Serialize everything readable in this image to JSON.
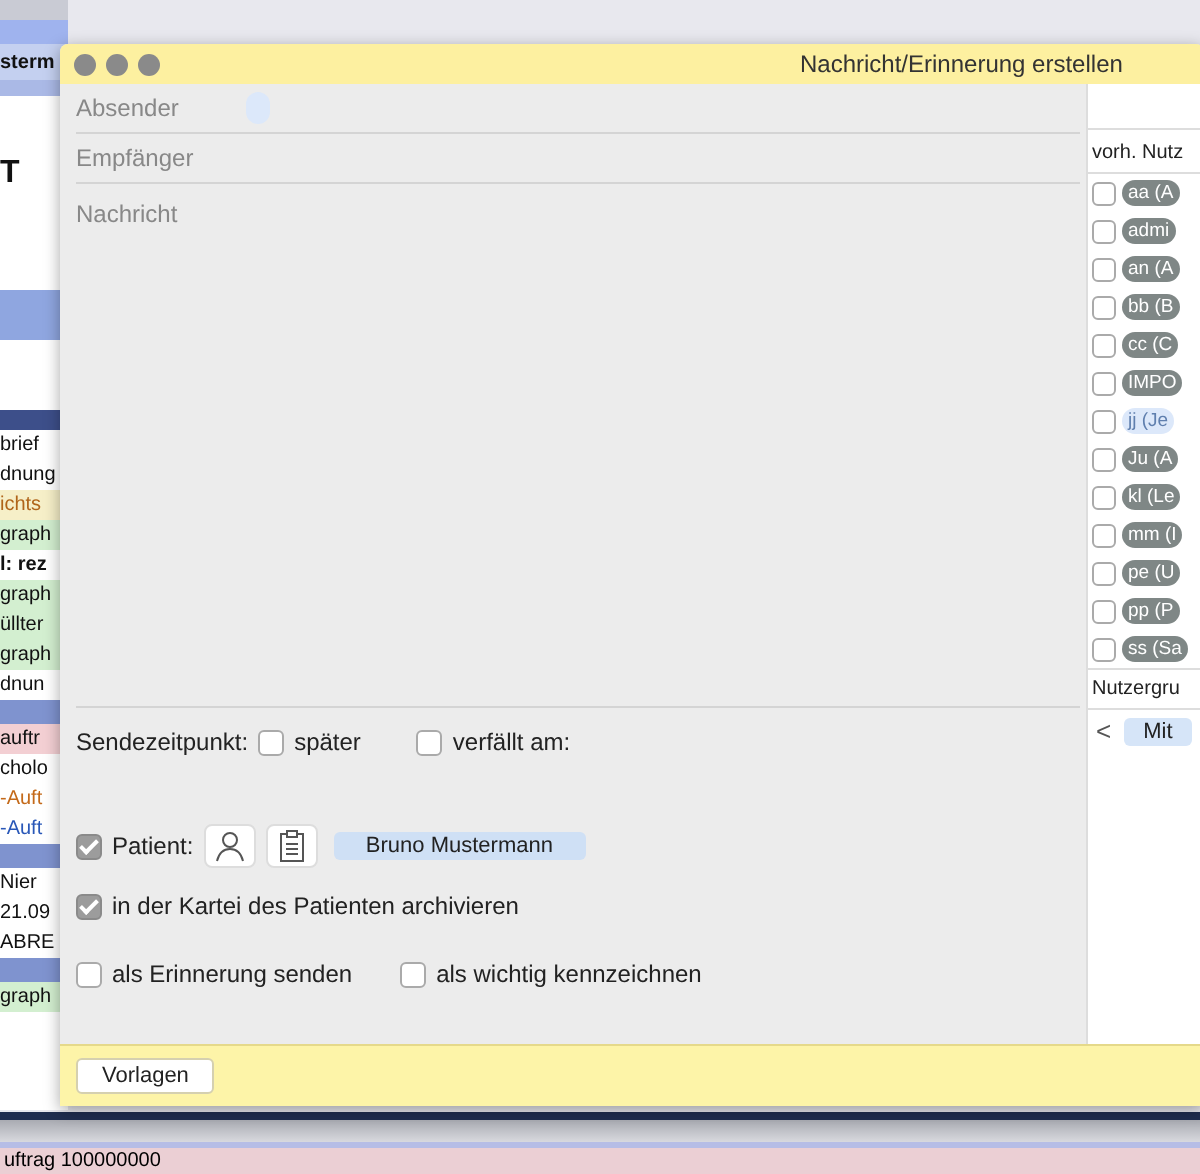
{
  "background_app": {
    "header": "sterm",
    "big_letter": "T",
    "rows": [
      {
        "text": "brief",
        "kind": "plain",
        "band_before": false
      },
      {
        "text": "dnung",
        "kind": "plain",
        "band_before": false
      },
      {
        "text": "ichts",
        "kind": "yellow",
        "band_before": false
      },
      {
        "text": "graph",
        "kind": "green",
        "band_before": false
      },
      {
        "text": "l: rez",
        "kind": "bold",
        "band_before": false
      },
      {
        "text": "graph",
        "kind": "green",
        "band_before": false
      },
      {
        "text": "üllter",
        "kind": "green",
        "band_before": false
      },
      {
        "text": "graph",
        "kind": "green",
        "band_before": false
      },
      {
        "text": "dnun",
        "kind": "plain",
        "band_before": false
      },
      {
        "text": "auftr",
        "kind": "pink",
        "band_before": true
      },
      {
        "text": "cholo",
        "kind": "plain",
        "band_before": false
      },
      {
        "text": "-Auft",
        "kind": "orange",
        "band_before": false
      },
      {
        "text": "-Auft",
        "kind": "blue",
        "band_before": false
      },
      {
        "text": "Nier",
        "kind": "plain",
        "band_before": true
      },
      {
        "text": "21.09",
        "kind": "plain",
        "band_before": false
      },
      {
        "text": "ABRE",
        "kind": "plain",
        "band_before": false
      },
      {
        "text": "graph",
        "kind": "green",
        "band_before": true
      }
    ],
    "footer": "uftrag 100000000"
  },
  "dialog": {
    "title": "Nachricht/Erinnerung erstellen",
    "sender_label": "Absender",
    "recipient_label": "Empfänger",
    "message_label": "Nachricht",
    "send_time_label": "Sendezeitpunkt:",
    "send_later": {
      "label": "später",
      "checked": false
    },
    "expires": {
      "label": "verfällt am:",
      "checked": false
    },
    "patient": {
      "label": "Patient:",
      "checked": true,
      "name": "Bruno Mustermann"
    },
    "archive": {
      "label": "in der Kartei des Patienten archivieren",
      "checked": true
    },
    "reminder": {
      "label": "als Erinnerung senden",
      "checked": false
    },
    "important": {
      "label": "als wichtig kennzeichnen",
      "checked": false
    },
    "templates_button": "Vorlagen",
    "users": {
      "heading": "vorh. Nutz",
      "items": [
        {
          "label": "aa (A",
          "checked": false,
          "highlighted": false
        },
        {
          "label": "admi",
          "checked": false,
          "highlighted": false
        },
        {
          "label": "an (A",
          "checked": false,
          "highlighted": false
        },
        {
          "label": "bb (B",
          "checked": false,
          "highlighted": false
        },
        {
          "label": "cc (C",
          "checked": false,
          "highlighted": false
        },
        {
          "label": "IMPO",
          "checked": false,
          "highlighted": false
        },
        {
          "label": "jj (Je",
          "checked": false,
          "highlighted": true
        },
        {
          "label": "Ju (A",
          "checked": false,
          "highlighted": false
        },
        {
          "label": "kl (Le",
          "checked": false,
          "highlighted": false
        },
        {
          "label": "mm (I",
          "checked": false,
          "highlighted": false
        },
        {
          "label": "pe (U",
          "checked": false,
          "highlighted": false
        },
        {
          "label": "pp (P",
          "checked": false,
          "highlighted": false
        },
        {
          "label": "ss (Sa",
          "checked": false,
          "highlighted": false
        }
      ]
    },
    "groups": {
      "heading": "Nutzergru",
      "back": "<",
      "chip": "Mit"
    }
  }
}
